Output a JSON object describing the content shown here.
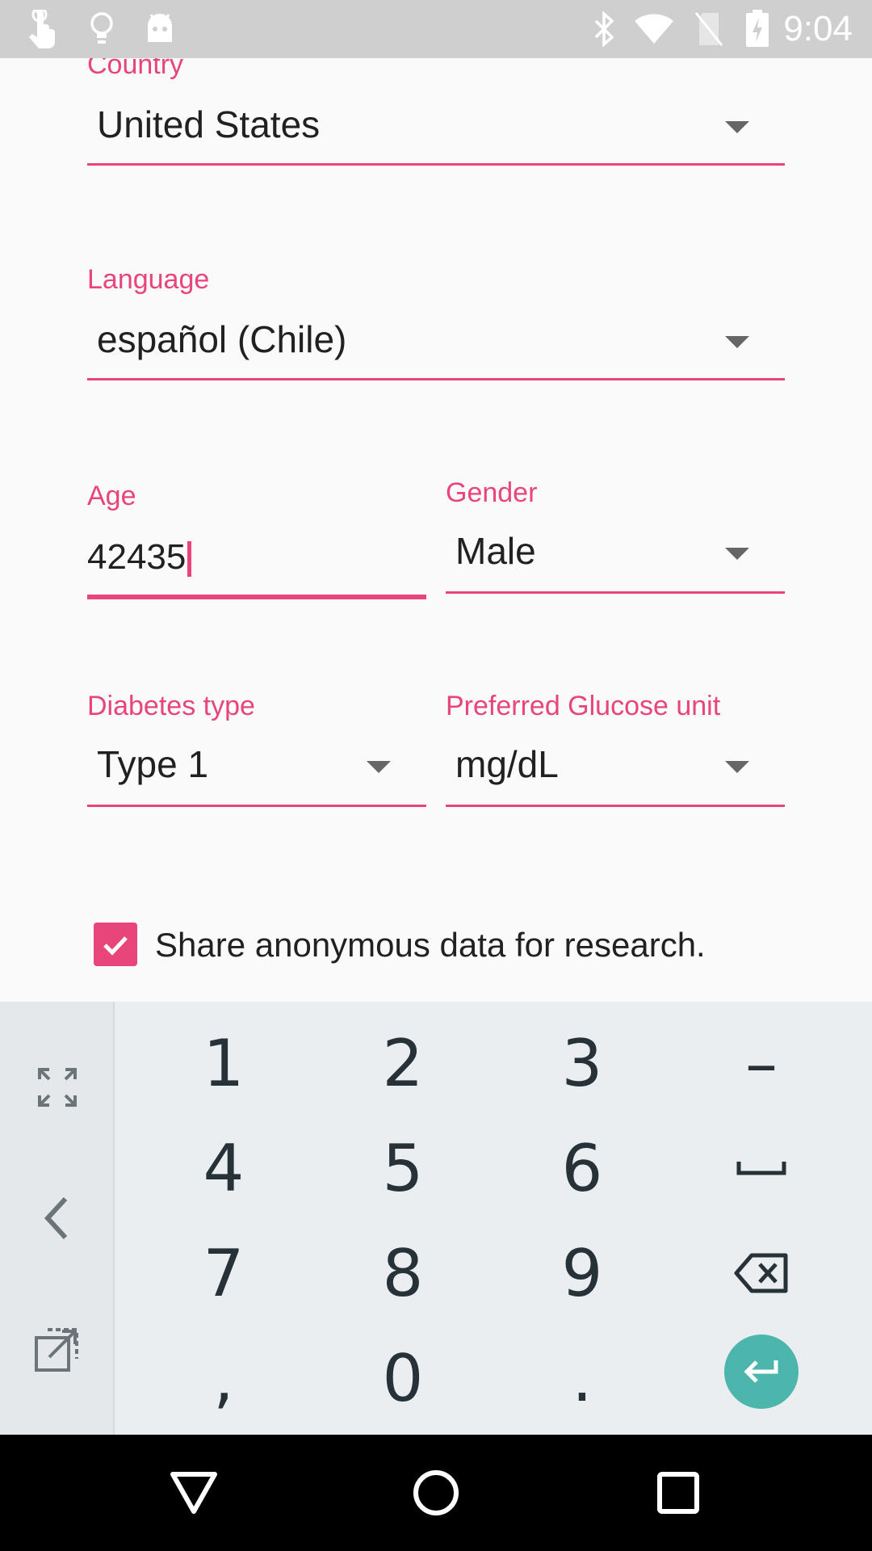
{
  "status_bar": {
    "time": "9:04",
    "icons": [
      "touch-icon",
      "lightbulb-icon",
      "android-icon",
      "bluetooth-icon",
      "wifi-icon",
      "no-sim-icon",
      "battery-charging-icon"
    ]
  },
  "form": {
    "country": {
      "label": "Country",
      "value": "United States"
    },
    "language": {
      "label": "Language",
      "value": "español (Chile)"
    },
    "age": {
      "label": "Age",
      "value": "42435"
    },
    "gender": {
      "label": "Gender",
      "value": "Male"
    },
    "diabetes_type": {
      "label": "Diabetes type",
      "value": "Type 1"
    },
    "glucose_unit": {
      "label": "Preferred Glucose unit",
      "value": "mg/dL"
    },
    "share_data": {
      "label": "Share anonymous data for research.",
      "checked": true
    }
  },
  "keyboard": {
    "rows": [
      [
        "1",
        "2",
        "3",
        "–"
      ],
      [
        "4",
        "5",
        "6",
        "space"
      ],
      [
        "7",
        "8",
        "9",
        "backspace"
      ],
      [
        ",",
        "0",
        ".",
        "enter"
      ]
    ],
    "side_buttons": [
      "expand-icon",
      "back-chevron-icon",
      "floating-keyboard-icon"
    ]
  },
  "colors": {
    "accent": "#e8457a",
    "enter": "#4db6ac",
    "status_bar": "#cfcfcf",
    "nav_bar": "#000000",
    "keyboard_bg": "#eaeef1"
  },
  "nav_bar": {
    "buttons": [
      "back-icon",
      "home-icon",
      "recents-icon"
    ]
  }
}
